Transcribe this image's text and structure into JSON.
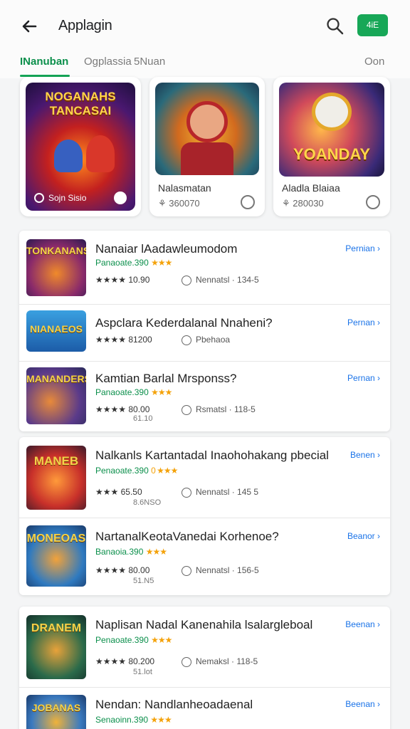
{
  "header": {
    "title": "Applagin",
    "action_label": "4iE",
    "back_icon": "arrow-left-icon",
    "search_icon": "search-icon"
  },
  "tabs": [
    {
      "label": "INanuban",
      "active": true
    },
    {
      "label": "Ogplassia",
      "active": false
    },
    {
      "label": "5Nuan",
      "active": false
    },
    {
      "label": "Oon",
      "active": false
    }
  ],
  "featured": [
    {
      "art_text": "NOGANAHS TANCASAI",
      "caption": "Sojn Sisio",
      "name": "",
      "meta": ""
    },
    {
      "art_text": "",
      "caption": "",
      "name": "Nalasmatan",
      "meta": "360070"
    },
    {
      "art_text": "YOANDAY",
      "caption": "",
      "name": "Aladla Blaiaa",
      "meta": "280030"
    }
  ],
  "list": [
    {
      "rows": [
        {
          "thumb": "TONKANANS",
          "title": "Nanaiar lAadawleumodom",
          "sub": "Panaoate.390",
          "stars": "★★★",
          "rating": "★★★★ 10.90",
          "rating2": "",
          "info": "Nennatsl · 134-5",
          "link": "Pernian ›"
        },
        {
          "thumb": "NIANAEOS",
          "title": "Aspclara Kederdalanal Nnaheni?",
          "sub": "",
          "stars": "",
          "rating": "★★★★ 81200",
          "rating2": "",
          "info": "Pbehaoa",
          "link": "Pernan ›"
        },
        {
          "thumb": "MANANDERS",
          "title": "Kamtian Barlal Mrsponss?",
          "sub": "Panaoate.390",
          "stars": "★★★",
          "rating": "★★★★ 80.00",
          "rating2": "61.10",
          "info": "Rsmatsl · 118-5",
          "link": "Pernan ›"
        }
      ]
    },
    {
      "rows": [
        {
          "thumb": "MANEB",
          "title": "Nalkanls Kartantadal Inaohohakang pbecial",
          "sub": "Penaoate.390",
          "stars": "0 ★★★",
          "rating": "★★★ 65.50",
          "rating2": "8.6NSO",
          "info": "Nennatsl · 145 5",
          "link": "Benen ›"
        },
        {
          "thumb": "MONEOAS",
          "title": "NartanalKeotaVanedai Korhenoe?",
          "sub": "Banaoia.390",
          "stars": "★★★",
          "rating": "★★★★ 80.00",
          "rating2": "51.N5",
          "info": "Nennatsl · 156-5",
          "link": "Beanor ›"
        }
      ]
    },
    {
      "rows": [
        {
          "thumb": "DRANEM",
          "title": "Naplisan Nadal Kanenahila lsalargleboal",
          "sub": "Penaoate.390",
          "stars": "★★★",
          "rating": "★★★★ 80.200",
          "rating2": "51.lot",
          "info": "Nemaksl · 118-5",
          "link": "Beenan ›"
        },
        {
          "thumb": "JOBANAS",
          "title": "Nendan: Nandlanheoadaenal",
          "sub": "Senaoinn.390",
          "stars": "★★★",
          "rating": "",
          "rating2": "",
          "info": "",
          "link": "Beenan ›"
        }
      ]
    }
  ]
}
